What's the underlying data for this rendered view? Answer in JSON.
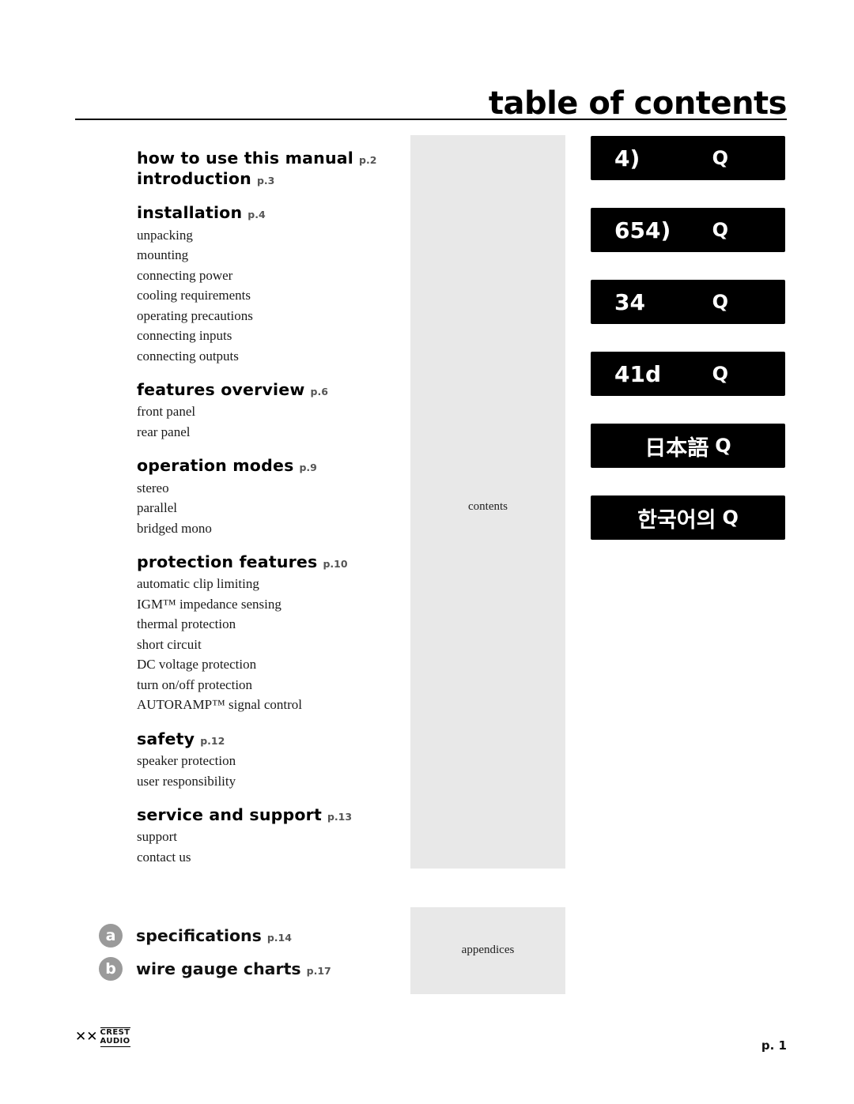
{
  "header": {
    "title": "table of contents"
  },
  "panels": {
    "contents_label": "contents",
    "appendices_label": "appendices"
  },
  "toc": {
    "groups": [
      {
        "heading": "how to use this manual",
        "page": "p.2",
        "items": []
      },
      {
        "heading": "introduction",
        "page": "p.3",
        "items": []
      },
      {
        "heading": "installation",
        "page": "p.4",
        "items": [
          "unpacking",
          "mounting",
          "connecting power",
          "cooling requirements",
          "operating precautions",
          "connecting inputs",
          "connecting outputs"
        ]
      },
      {
        "heading": "features overview",
        "page": "p.6",
        "items": [
          "front panel",
          "rear panel"
        ]
      },
      {
        "heading": "operation modes",
        "page": "p.9",
        "items": [
          "stereo",
          "parallel",
          "bridged mono"
        ]
      },
      {
        "heading": "protection features",
        "page": "p.10",
        "items": [
          "automatic clip limiting",
          "IGM™ impedance sensing",
          "thermal protection",
          "short circuit",
          "DC voltage protection",
          "turn on/off protection",
          "AUTORAMP™ signal control"
        ]
      },
      {
        "heading": "safety",
        "page": "p.12",
        "items": [
          "speaker protection",
          "user responsibility"
        ]
      },
      {
        "heading": "service and support",
        "page": "p.13",
        "items": [
          "support",
          "contact us"
        ]
      }
    ]
  },
  "appendices": [
    {
      "bullet": "a",
      "label": "specifications",
      "page": "p.14"
    },
    {
      "bullet": "b",
      "label": "wire gauge charts",
      "page": "p.17"
    }
  ],
  "languages": [
    {
      "left": "4)",
      "right": "Q",
      "cjk": false
    },
    {
      "left": "654)",
      "right": "Q",
      "cjk": false
    },
    {
      "left": "34",
      "right": "Q",
      "cjk": false
    },
    {
      "left": "41d",
      "right": "Q",
      "cjk": false
    },
    {
      "left": "日本語",
      "right": "Q",
      "cjk": true
    },
    {
      "left": "한국어의",
      "right": "Q",
      "cjk": true
    }
  ],
  "footer": {
    "logo_mark": "✕✕",
    "logo_line1": "CREST",
    "logo_line2": "AUDIO",
    "page_number": "p. 1"
  }
}
